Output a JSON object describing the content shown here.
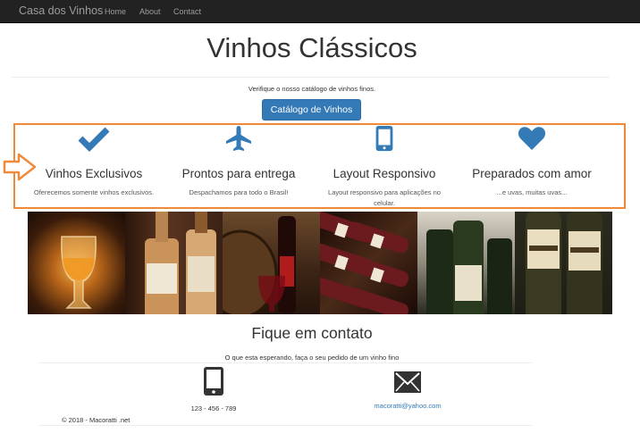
{
  "nav": {
    "brand": "Casa dos Vinhos",
    "links": [
      "Home",
      "About",
      "Contact"
    ]
  },
  "header": {
    "title": "Vinhos Clássicos",
    "subtitle": "Verifique o nosso catálogo de vinhos finos.",
    "catalog_button": "Catálogo de Vinhos"
  },
  "features": [
    {
      "icon": "check-icon",
      "title": "Vinhos Exclusivos",
      "text": "Oferecemos somente vinhos exclusivos."
    },
    {
      "icon": "airplane-icon",
      "title": "Prontos para entrega",
      "text": "Despachamos para todo o Brasil!"
    },
    {
      "icon": "phone-icon",
      "title": "Layout Responsivo",
      "text": "Layout responsivo para aplicações no celular."
    },
    {
      "icon": "heart-icon",
      "title": "Preparados com amor",
      "text": "...e uvas, muitas uvas..."
    }
  ],
  "contact": {
    "title": "Fique em contato",
    "subtitle": "O que esta esperando, faça o seu pedido de um vinho fino",
    "phone": "123 - 456 - 789",
    "email": "macoratti@yahoo.com"
  },
  "footer": {
    "text": "© 2018 - Macoratti .net"
  },
  "colors": {
    "navbar": "#222222",
    "primary": "#337ab7",
    "highlight": "#ef8a3a"
  }
}
